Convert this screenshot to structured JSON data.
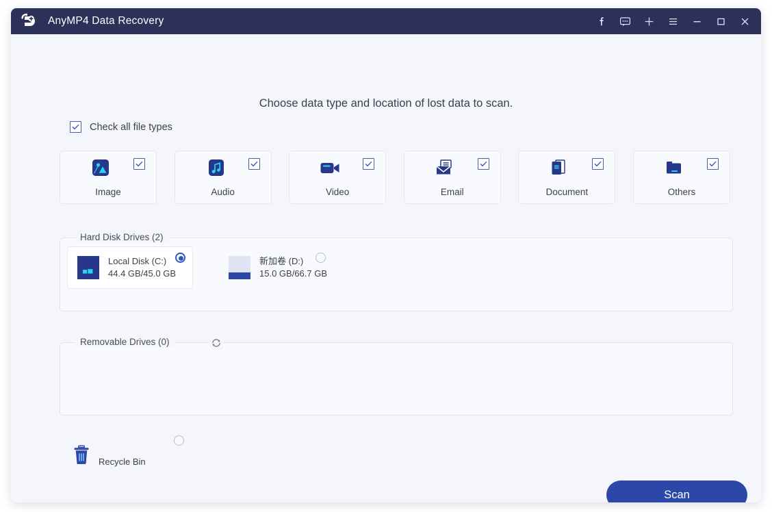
{
  "window": {
    "title": "AnyMP4 Data Recovery",
    "logo_icon": "data-recovery-logo-icon",
    "controls": [
      {
        "name": "facebook-icon",
        "glyph": "f"
      },
      {
        "name": "feedback-chat-icon",
        "glyph": "chat"
      },
      {
        "name": "add-plus-icon",
        "glyph": "+"
      },
      {
        "name": "hamburger-menu-icon",
        "glyph": "menu"
      },
      {
        "name": "minimize-icon",
        "glyph": "minimize"
      },
      {
        "name": "maximize-icon",
        "glyph": "maximize"
      },
      {
        "name": "close-icon",
        "glyph": "close"
      }
    ]
  },
  "main": {
    "heading": "Choose data type and location of lost data to scan.",
    "check_all_label": "Check all file types",
    "check_all_checked": true,
    "file_types": [
      {
        "label": "Image",
        "icon": "image-icon",
        "checked": true
      },
      {
        "label": "Audio",
        "icon": "audio-icon",
        "checked": true
      },
      {
        "label": "Video",
        "icon": "video-icon",
        "checked": true
      },
      {
        "label": "Email",
        "icon": "email-icon",
        "checked": true
      },
      {
        "label": "Document",
        "icon": "document-icon",
        "checked": true
      },
      {
        "label": "Others",
        "icon": "others-folder-icon",
        "checked": true
      }
    ],
    "hard_disk_group_title": "Hard Disk Drives (2)",
    "drives": [
      {
        "name": "Local Disk (C:)",
        "size": "44.4 GB/45.0 GB",
        "icon": "windows-drive-icon",
        "selected": true
      },
      {
        "name": "新加卷 (D:)",
        "size": "15.0 GB/66.7 GB",
        "icon": "local-drive-icon",
        "selected": false
      }
    ],
    "removable_group_title": "Removable Drives (0)",
    "refresh_icon": "refresh-icon",
    "removable_drives": [],
    "recycle_bin": {
      "label": "Recycle Bin",
      "icon": "recycle-bin-icon",
      "selected": false
    },
    "scan_button_label": "Scan"
  },
  "colors": {
    "titlebar": "#2b3159",
    "body": "#f4f6fb",
    "accent": "#2b47a8",
    "icon_dark_blue": "#27388c",
    "icon_cyan": "#29d3f0"
  }
}
